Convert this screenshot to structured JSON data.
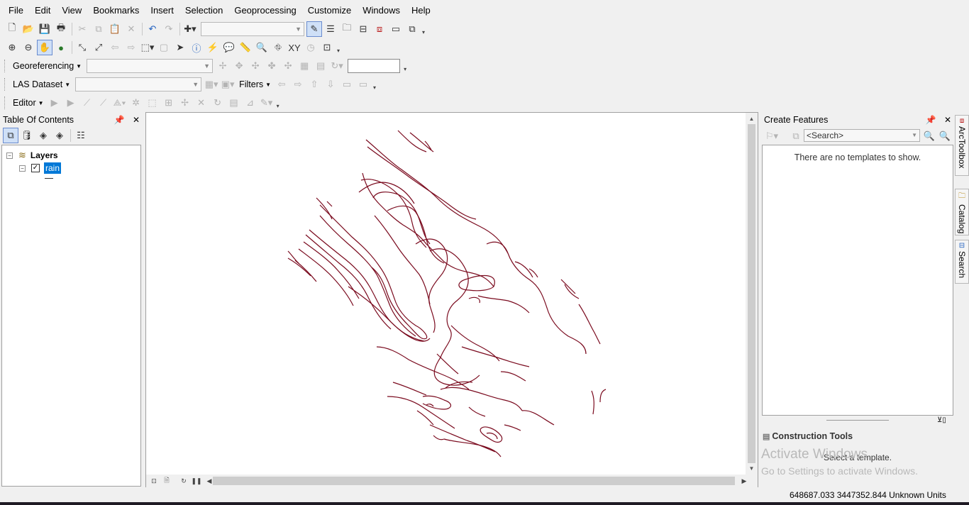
{
  "menu": [
    "File",
    "Edit",
    "View",
    "Bookmarks",
    "Insert",
    "Selection",
    "Geoprocessing",
    "Customize",
    "Windows",
    "Help"
  ],
  "toolbars": {
    "georeferencing_label": "Georeferencing",
    "las_dataset_label": "LAS Dataset",
    "filters_label": "Filters",
    "editor_label": "Editor"
  },
  "toc": {
    "title": "Table Of Contents",
    "root_label": "Layers",
    "layer_name": "rain",
    "layer_visible": true
  },
  "create_features": {
    "title": "Create Features",
    "search_placeholder": "<Search>",
    "empty_message": "There are no templates to show.",
    "construction_tools_title": "Construction Tools",
    "construction_tools_message": "Select a template."
  },
  "watermark": {
    "line1": "Activate Windows",
    "line2": "Go to Settings to activate Windows."
  },
  "side_tabs": [
    "ArcToolbox",
    "Catalog",
    "Search"
  ],
  "status": {
    "coordinates": "648687.033  3447352.844 Unknown Units"
  },
  "colors": {
    "contour": "#7a0a1e",
    "selection": "#0078d7"
  }
}
